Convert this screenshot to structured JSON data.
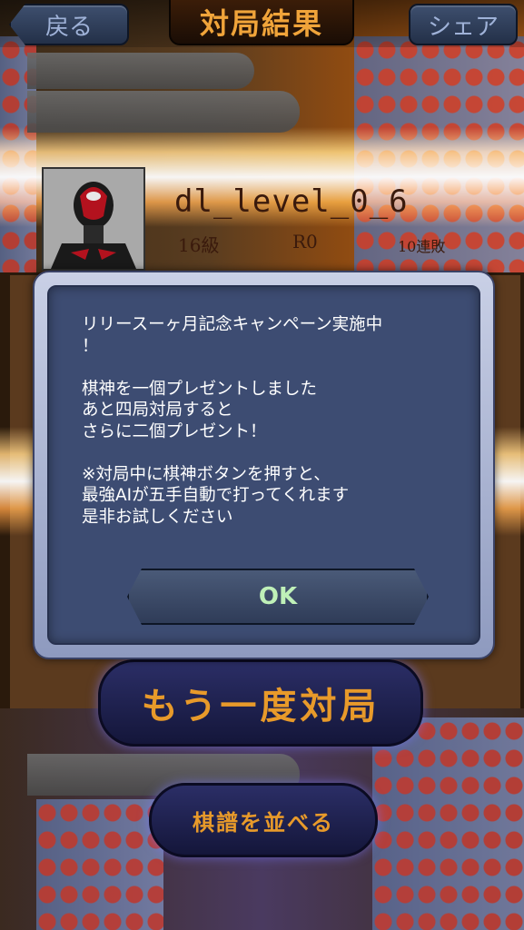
{
  "header": {
    "back_label": "戻る",
    "title": "対局結果",
    "share_label": "シェア"
  },
  "player": {
    "name": "dl_level_0_6",
    "rank": "16級",
    "rating": "R0",
    "streak": "10連敗"
  },
  "dialog": {
    "message": "リリースーヶ月記念キャンペーン実施中\n！\n\n棋神を一個プレゼントしました\nあと四局対局すると\nさらに二個プレゼント！\n\n※対局中に棋神ボタンを押すと、\n最強AIが五手自動で打ってくれます\n是非お試しください",
    "ok_label": "OK"
  },
  "actions": {
    "play_again_label": "もう一度対局",
    "show_kifu_label": "棋譜を並べる"
  }
}
